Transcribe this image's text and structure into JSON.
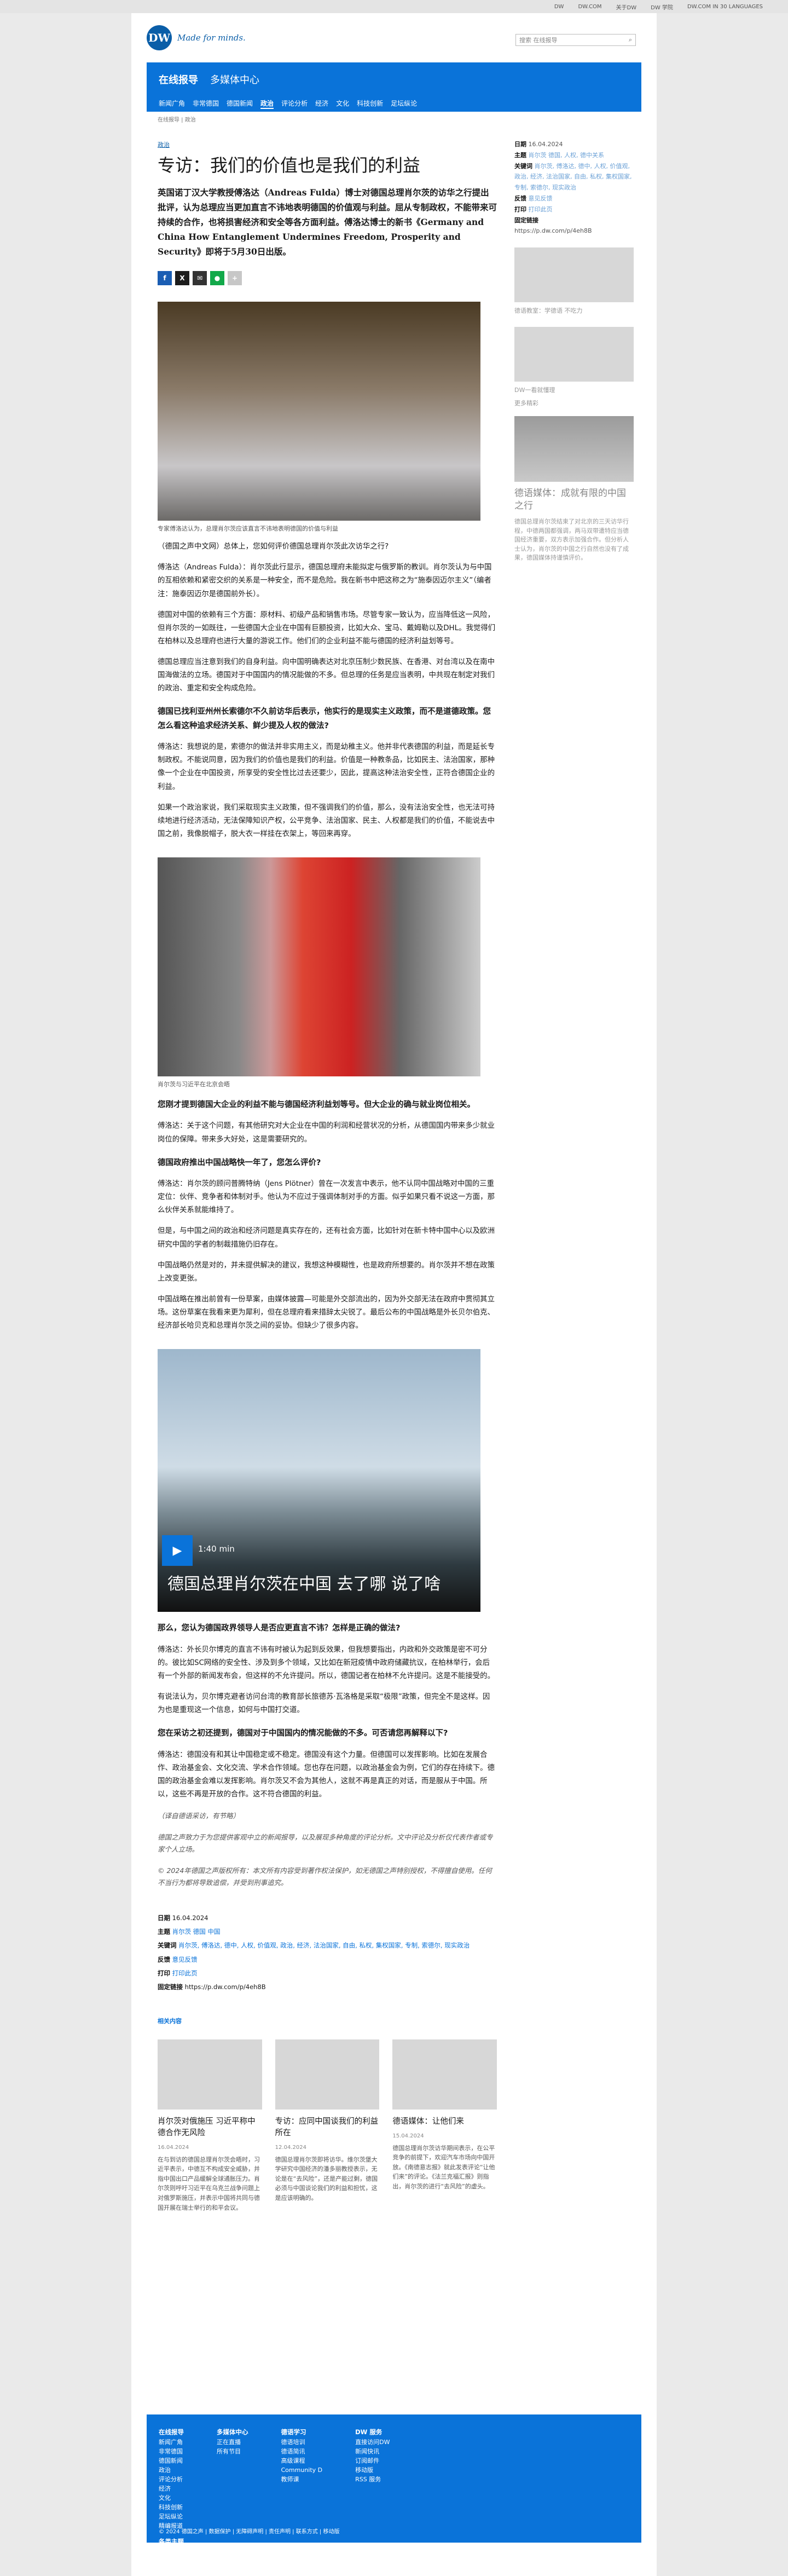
{
  "topbar": [
    "DW",
    "DW.COM",
    "关于DW",
    "DW 学院",
    "DW.COM IN 30 LANGUAGES"
  ],
  "brand": {
    "logo": "DW",
    "tagline": "Made for minds.",
    "search_placeholder": "搜索 在线报导"
  },
  "nav": {
    "primary": [
      "在线报导",
      "多媒体中心"
    ],
    "secondary": [
      "新闻广角",
      "非常德国",
      "德国新闻",
      "政治",
      "评论分析",
      "经济",
      "文化",
      "科技创新",
      "足坛纵论"
    ],
    "active": "政治"
  },
  "breadcrumb": "在线报导 | 政治",
  "article": {
    "kicker": "政治",
    "title": "专访：我们的价值也是我们的利益",
    "lead": "英国诺丁汉大学教授傅洛达（Andreas Fulda）博士对德国总理肖尔茨的访华之行提出批评，认为总理应当更加直言不讳地表明德国的价值观与利益。屈从专制政权，不能带来可持续的合作，也将损害经济和安全等各方面利益。傅洛达博士的新书《Germany and China How Entanglement Undermines Freedom, Prosperity and Security》即将于5月30日出版。",
    "share": [
      "f",
      "X",
      "✉",
      "●",
      "+"
    ],
    "fig1_caption": "专家傅洛达认为，总理肖尔茨应该直言不讳地表明德国的价值与利益",
    "p1": "（德国之声中文网）总体上，您如何评价德国总理肖尔茨此次访华之行?",
    "p2": "傅洛达（Andreas Fulda）：肖尔茨此行显示，德国总理府未能拟定与俄罗斯的教训。肖尔茨认为与中国的互相依赖和紧密交织的关系是一种安全，而不是危险。我在新书中把这称之为“施泰因迈尔主义”（编者注：施泰因迈尔是德国前外长）。",
    "p3": "德国对中国的依赖有三个方面：原材料、初级产品和销售市场。尽管专家一致认为，应当降低这一风险，但肖尔茨的一如既往，一些德国大企业在中国有巨额投资，比如大众、宝马、戴姆勒以及DHL。我觉得们在柏林以及总理府也进行大量的游说工作。他们们的企业利益不能与德国的经济利益划等号。",
    "p4": "德国总理应当注意到我们的自身利益。向中国明确表达对北京压制少数民族、在香港、对台湾以及在南中国海做法的立场。德国对于中国国内的情况能做的不多。但总理的任务是应当表明，中共现在制定对我们的政治、重定和安全构成危险。",
    "q1": "德国已找利亚州州长索德尔不久前访华后表示，他实行的是现实主义政策，而不是道德政策。您怎么看这种追求经济关系、鲜少提及人权的做法?",
    "p5": "傅洛达：我想说的是，索德尔的做法并非实用主义，而是幼稚主义。他并非代表德国的利益，而是延长专制政权。不能说同意，因为我们的价值也是我们的利益。价值是一种教条品，比如民主、法治国家，那种像一个企业在中国投资，所享受的安全性比过去还要少，因此，提高这种法治安全性，正符合德国企业的利益。",
    "p6": "如果一个政治家说，我们采取现实主义政策，但不强调我们的价值，那么，没有法治安全性，也无法可持续地进行经济活动，无法保障知识产权，公平竞争、法治国家、民主、人权都是我们的价值，不能说去中国之前，我像脱帽子，脱大衣一样挂在衣架上，等回来再穿。",
    "fig2_caption": "肖尔茨与习近平在北京会晤",
    "q2": "您刚才提到德国大企业的利益不能与德国经济利益划等号。但大企业的确与就业岗位相关。",
    "p7": "傅洛达：关于这个问题，有其他研究对大企业在中国的利润和经营状况的分析，从德国国内带来多少就业岗位的保障。带来多大好处，这是需要研究的。",
    "q3": "德国政府推出中国战略快一年了，您怎么评价?",
    "p8": "傅洛达：肖尔茨的顾问普腾特纳（Jens Plötner）曾在一次发言中表示，他不认同中国战略对中国的三重定位：伙伴、竞争者和体制对手。他认为不应过于强调体制对手的方面。似乎如果只看不说这一方面，那么伙伴关系就能维持了。",
    "p9": "但是，与中国之间的政治和经济问题是真实存在的，还有社会方面，比如针对在新卡特中国中心以及欧洲研究中国的学者的制裁措施仍旧存在。",
    "p10": "中国战略仍然是对的，并未提供解决的建议，我想这种模糊性，也是政府所想要的。肖尔茨并不想在政策上改变更张。",
    "p11": "中国战略在推出前曾有一份草案，由媒体披露—可能是外交部流出的，因为外交部无法在政府中贯彻其立场。这份草案在我看来更为犀利，但在总理府看来措辞太尖锐了。最后公布的中国战略是外长贝尔伯克、经济部长哈贝克和总理肖尔茨之间的妥协。但缺少了很多内容。",
    "video_duration": "1:40 min",
    "video_title": "德国总理肖尔茨在中国 去了哪 说了啥",
    "q4": "那么，您认为德国政界领导人是否应更直言不讳？怎样是正确的做法?",
    "p12": "傅洛达：外长贝尔博克的直言不讳有时被认为起到反效果，但我想要指出，内政和外交政策是密不可分的。彼比如SC网络的安全性、涉及到多个领域，又比如在新冠疫情中政府储藏抗议，在柏林举行，会后有一个外部的新闻发布会，但这样的不允许提问。所以，德国记者在柏林不允许提问。这是不能接受的。",
    "p13": "有说法认为，贝尔博克避者访问台湾的教育部长旅德苏·瓦洛格是采取“极限”政策，但完全不是这样。因为也是重现这一个信息，如何与中国打交道。",
    "q5": "您在采访之初还提到，德国对于中国国内的情况能做的不多。可否请您再解释以下?",
    "p14": "傅洛达：德国没有和其让中国稳定或不稳定。德国没有这个力量。但德国可以发挥影响。比如在发展合作、政治基金会、文化交流、学术合作领域。您也存在问题，以政治基金会为例，它们的存在持续下。德国的政治基金会难以发挥影响。肖尔茨又不会为其他人，这就不再是真正的对话，而是服从于中国。所以，这些不再是开放的合作。这不符合德国的利益。",
    "p15": "（译自德语采访，有节略）",
    "p16": "德国之声致力于为您提供客观中立的新闻报导，以及展现多种角度的评论分析。文中评论及分析仅代表作者或专家个人立场。",
    "p17": "© 2024年德国之声版权所有：本文所有内容受到著作权法保护，如无德国之声特别授权，不得擅自使用。任何不当行为都将导致追偿，并受到刑事追究。"
  },
  "meta": {
    "date_label": "日期",
    "date": "16.04.2024",
    "topic_label": "主题",
    "topics": "肖尔茨 德国 中国",
    "kw_label": "关键词",
    "keywords": "肖尔茨, 傅洛达, 德中, 人权, 价值观, 政治, 经济, 法治国家, 自由, 私权, 集权国家, 专制, 索德尔, 现实政治",
    "fb_label": "反馈",
    "fb": "意见反馈",
    "print_label": "打印",
    "print": "打印此页",
    "link_label": "固定链接",
    "link": "https://p.dw.com/p/4eh8B"
  },
  "related": {
    "heading": "相关内容",
    "cards": [
      {
        "title": "肖尔茨对俄施压 习近平称中德合作无风险",
        "date": "16.04.2024",
        "text": "在与到访的德国总理肖尔茨会晤时，习近平表示，中德互不构成安全威胁，并指中国出口产品缓解全球通胀压力。肖尔茨则呼吁习近平在乌克兰战争问题上对俄罗斯施压，并表示中国将共同与德国开展在瑞士举行的和平会议。"
      },
      {
        "title": "专访：应同中国谈我们的利益所在",
        "date": "12.04.2024",
        "text": "德国总理肖尔茨即将访华。维尔茨堡大学研究中国经济的潘多丽教授表示，无论是在“去风险”，还是产能过剩，德国必须与中国谈论我们的利益和担忧，这是应该明确的。"
      },
      {
        "title": "德语媒体：让他们来",
        "date": "15.04.2024",
        "text": "德国总理肖尔茨访华期间表示，在公平竞争的前提下，欢迎汽车市场向中国开放。《南德意志报》就此发表评论“让他们来”的评论。《法兰克福汇报》则指出，肖尔茨的进行“去风险”的虚头。"
      }
    ]
  },
  "sidebar": {
    "date_label": "日期",
    "date": "16.04.2024",
    "topic_label": "主题",
    "topics": "肖尔茨 德国, 人权, 德中关系",
    "kw_label": "关键词",
    "keywords": "肖尔茨, 傅洛达, 德中, 人权, 价值观, 政治, 经济, 法治国家, 自由, 私权, 集权国家, 专制, 索德尔, 现实政治",
    "fb_label": "反馈",
    "fb": "意见反馈",
    "print_label": "打印",
    "print": "打印此页",
    "link_label": "固定链接",
    "link": "https://p.dw.com/p/4eh8B",
    "promo1": "德语教室：学德语 不吃力",
    "promo2": "DW一看就懂理",
    "more_label": "更多精彩",
    "story_title": "德语媒体：成就有限的中国之行",
    "story_text": "德国总理肖尔茨结束了对北京的三天访华行程，中德两国都强调，两马双带遭特应当德国经济重要，双方表示加强合作。但分析人士认为，肖尔茨的中国之行自然也没有了成果，德国媒体持谨慎评价。"
  },
  "footer": {
    "cols": [
      {
        "title": "在线报导",
        "items": [
          "新闻广角",
          "非常德国",
          "德国新闻",
          "政治",
          "评论分析",
          "经济",
          "文化",
          "科技创新",
          "足坛纵论",
          "精编报道"
        ]
      },
      {
        "title": "多媒体中心",
        "items": [
          "正在直播",
          "所有节目"
        ]
      },
      {
        "title": "德语学习",
        "items": [
          "德语培训",
          "德语简讯",
          "高级课程",
          "Community D",
          "教师课"
        ]
      },
      {
        "title": "DW 服务",
        "items": [
          "直接访问DW",
          "新闻快讯",
          "订阅邮件",
          "移动版",
          "RSS 服务"
        ]
      }
    ],
    "extra": "各类主题",
    "copyright": "© 2024 德国之声 | 数据保护 | 无障碍声明 | 责任声明 | 联系方式 | 移动版"
  }
}
